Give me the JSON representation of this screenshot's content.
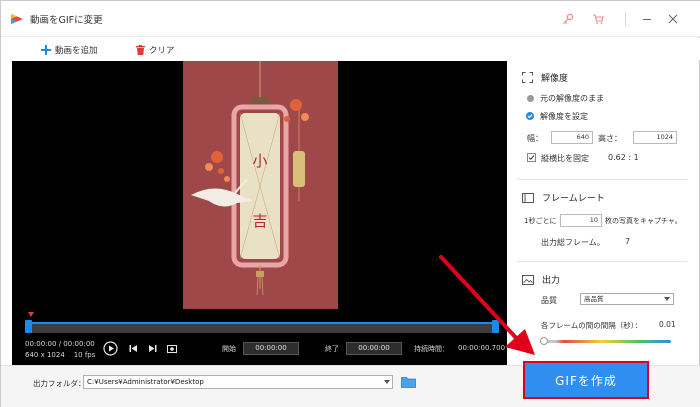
{
  "window": {
    "title": "動画をGIFに変更"
  },
  "toolbar": {
    "add_video": "動画を追加",
    "clear": "クリア"
  },
  "timeline": {
    "time_current": "00:00:00",
    "time_separator": "/",
    "time_total": "00:00:00",
    "resolution": "640 x 1024",
    "fps": "10 fps",
    "start_label": "開始",
    "start_value": "00:00:00",
    "end_label": "終了",
    "end_value": "00:00:00",
    "duration_label": "持続時間：",
    "duration_value": "00:00:00.700"
  },
  "output": {
    "folder_label": "出力フォルダ：",
    "folder_path": "C:¥Users¥Administrator¥Desktop"
  },
  "create_button": "GIFを作成",
  "resolution_section": {
    "title": "解像度",
    "option_original": "元の解像度のまま",
    "option_custom": "解像度を設定",
    "width_label": "幅：",
    "width_value": "640",
    "height_label": "高さ：",
    "height_value": "1024",
    "aspect_label": "縦横比を固定",
    "aspect_value": "0.62 : 1"
  },
  "framerate_section": {
    "title": "フレームレート",
    "per_second_prefix": "1秒ごとに",
    "per_second_value": "10",
    "per_second_suffix": "枚の写真をキャプチャ。",
    "total_frames_label": "出力総フレーム。",
    "total_frames_value": "7"
  },
  "output_section": {
    "title": "出力",
    "quality_label": "品質",
    "quality_value": "高品質",
    "interval_label": "各フレームの間の間隔（秒）：",
    "interval_value": "0.01"
  },
  "colors": {
    "accent": "#2f8ff0",
    "highlight_border": "#e0001b",
    "arrow": "#e0001b",
    "video_bg": "#a0474a"
  }
}
